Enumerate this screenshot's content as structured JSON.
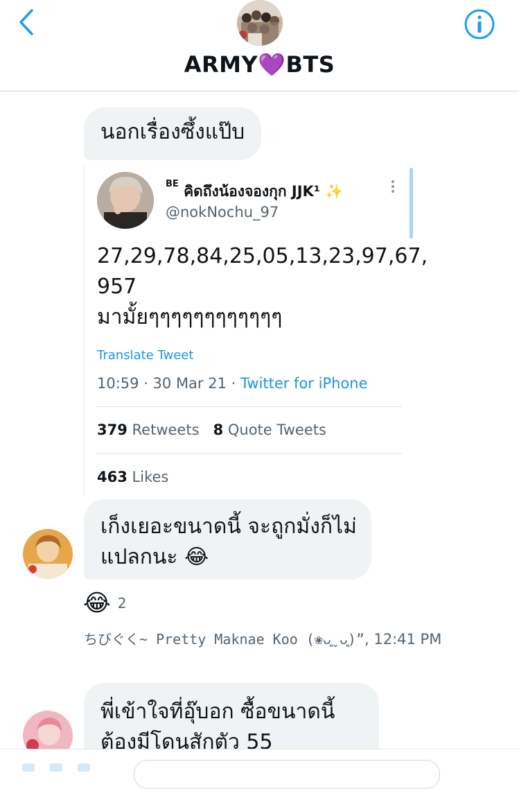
{
  "header": {
    "title": "ARMY💜BTS"
  },
  "messages": {
    "first": {
      "text": "นอกเรื่องซึ้งแป๊บ"
    },
    "quoted_tweet": {
      "sup": "BE",
      "name": "คิดถึงน้องจองกุก JJK¹",
      "emoji": "✨",
      "handle": "@nokNochu_97",
      "text": "27,29,78,84,25,05,13,23,97,67,\n957\nมามั้ยๆๆๆๆๆๆๆๆๆๆๆๆ",
      "translate": "Translate Tweet",
      "time_date": "10:59 · 30 Mar 21 · ",
      "source": "Twitter for iPhone",
      "retweets_count": "379",
      "retweets_label": "Retweets",
      "quotes_count": "8",
      "quotes_label": "Quote Tweets",
      "likes_count": "463",
      "likes_label": "Likes"
    },
    "second": {
      "text": "เก็งเยอะขนาดนี้ จะถูกมั่งก็ไม่แปลกนะ 😂",
      "reaction_emoji": "😂",
      "reaction_count": "2",
      "sender": "ちびぐく~ Pretty Maknae Koo (❀ᴗ͈ˬᴗ͈)”",
      "time": ", 12:41 PM"
    },
    "third": {
      "text": "พี่เข้าใจที่อุ๊บอก ซื้อขนาดนี้ต้องมีโดนสักตัว 55"
    }
  },
  "colors": {
    "accent": "#1d9bf0",
    "bubble": "#eff3f4",
    "secondary_text": "#536471"
  },
  "icons": [
    "chevron-left-icon",
    "info-icon",
    "more-vertical-icon"
  ]
}
